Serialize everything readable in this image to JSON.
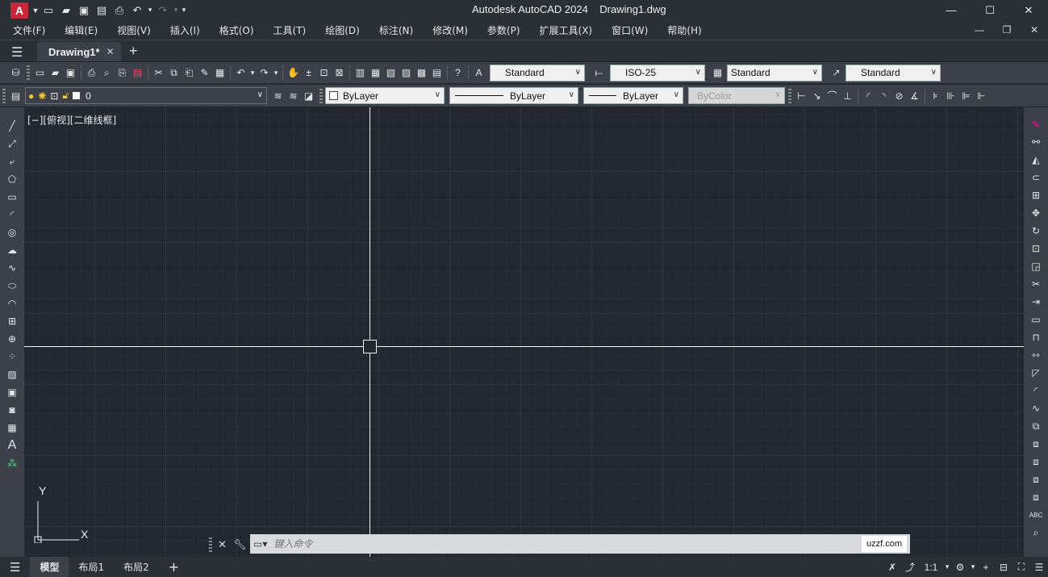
{
  "app": {
    "logo_letter": "A",
    "title": "Autodesk AutoCAD 2024    Drawing1.dwg"
  },
  "menu": [
    "文件(F)",
    "编辑(E)",
    "视图(V)",
    "插入(I)",
    "格式(O)",
    "工具(T)",
    "绘图(D)",
    "标注(N)",
    "修改(M)",
    "参数(P)",
    "扩展工具(X)",
    "窗口(W)",
    "帮助(H)"
  ],
  "tabs": {
    "document": "Drawing1*"
  },
  "toolbar1": {
    "text_style": "Standard",
    "dim_style": "ISO-25",
    "table_style": "Standard",
    "multileader_style": "Standard"
  },
  "toolbar2": {
    "layer": "0",
    "color": "ByLayer",
    "linetype": "ByLayer",
    "lineweight": "ByLayer",
    "plotstyle": "ByColor"
  },
  "viewport": {
    "label": "[−][俯视][二维线框]"
  },
  "ucs": {
    "x_label": "X",
    "y_label": "Y"
  },
  "command": {
    "placeholder": "键入命令",
    "watermark": "uzzf.com"
  },
  "status": {
    "tabs": [
      "模型",
      "布局1",
      "布局2"
    ],
    "scale": "1:1"
  },
  "colors": {
    "canvas": "#212830",
    "chrome": "#2b2f36",
    "toolbar": "#3b4049",
    "logo": "#c8283a"
  }
}
